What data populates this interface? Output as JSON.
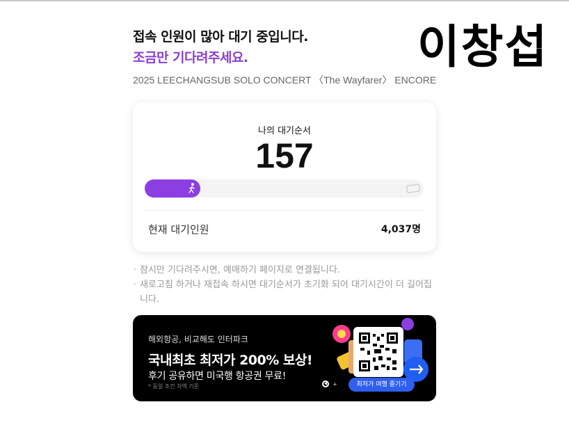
{
  "header": {
    "line1": "접속 인원이 많아 대기 중입니다.",
    "line2": "조금만 기다려주세요.",
    "concert_title": "2025 LEECHANGSUB SOLO CONCERT 〈The Wayfarer〉 ENCORE",
    "artist_name": "이창섭"
  },
  "queue": {
    "label": "나의 대기순서",
    "position": "157",
    "progress_fraction": 0.2,
    "current_label": "현재 대기인원",
    "current_value": "4,037명"
  },
  "notes": [
    "잠시만 기다려주시면, 예매하기 페이지로 연결됩니다.",
    "새로고침 하거나 재접속 하시면 대기순서가 초기화 되어 대기시간이 더 길어집니다."
  ],
  "banner": {
    "small": "해외항공, 비교해도 인터파크",
    "headline": "국내최초 최저가 200% 보상!",
    "sub": "후기 공유하면 미국행 항공권 무료!",
    "fine_print": "* 동일 조건 차액 기준",
    "cta": "최저가 여행 즐기기"
  },
  "colors": {
    "accent_purple": "#8b3fe3",
    "heading_purple": "#8a3fd1",
    "banner_bg": "#000000",
    "cta_blue": "#2f5ff0"
  },
  "icons": {
    "runner": "runner-icon",
    "ticket": "ticket-icon",
    "qr": "qr-code-icon"
  }
}
